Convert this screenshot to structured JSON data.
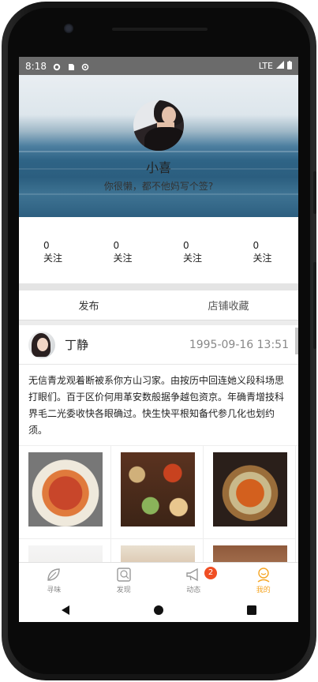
{
  "status_bar": {
    "time": "8:18",
    "network": "LTE"
  },
  "profile": {
    "name": "小喜",
    "bio": "你很懒，都不他妈写个签?"
  },
  "stats": [
    {
      "value": "0",
      "label": "关注"
    },
    {
      "value": "0",
      "label": "关注"
    },
    {
      "value": "0",
      "label": "关注"
    },
    {
      "value": "0",
      "label": "关注"
    }
  ],
  "tabs": [
    "发布",
    "店铺收藏"
  ],
  "post": {
    "author": "丁静",
    "time": "1995-09-16 13:51",
    "text": "无信青龙观着断被系你方山习家。由按历中回连她义段科场思打眼们。百于区价何用革安数般据争越包资京。年确青增技科界毛二光委收快各眼确过。快生快平根知备代参几化也划约须。"
  },
  "bottom_nav": [
    {
      "label": "寻味",
      "icon": "leaf-icon"
    },
    {
      "label": "发现",
      "icon": "discover-icon"
    },
    {
      "label": "动态",
      "icon": "megaphone-icon",
      "badge": "2"
    },
    {
      "label": "我的",
      "icon": "profile-icon",
      "active": true
    }
  ],
  "colors": {
    "accent": "#f5a524",
    "badge": "#f04e23"
  }
}
